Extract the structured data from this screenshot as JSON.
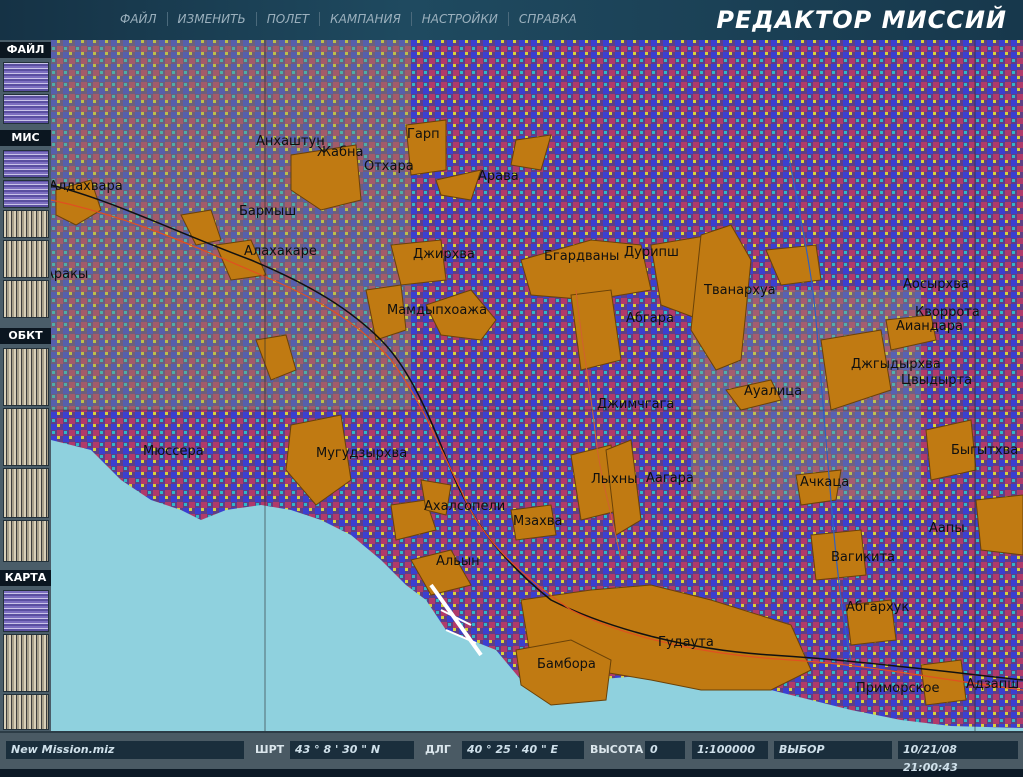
{
  "menu": [
    "ФАЙЛ",
    "ИЗМЕНИТЬ",
    "ПОЛЕТ",
    "КАМПАНИЯ",
    "НАСТРОЙКИ",
    "СПРАВКА"
  ],
  "app_title": "РЕДАКТОР МИССИЙ",
  "sections": {
    "file": "ФАЙЛ",
    "mission": "МИС",
    "object": "ОБКТ",
    "map": "КАРТА"
  },
  "cities": [
    "Анхаштун",
    "Жабна",
    "Отхара",
    "Гарп",
    "Арава",
    "Алдахвара",
    "Бармыш",
    "Алахакаре",
    "Джирхва",
    "Бгардваны",
    "Дурипш",
    "Тванархуа",
    "Аосырхва",
    "Кворрота",
    "Аиандара",
    "Цвыдырта",
    "Джгыдырхва",
    "Аракы",
    "Мамдыпхоажа",
    "Абгара",
    "Ауалица",
    "Джимчгага",
    "Мюссера",
    "Мугудзырхва",
    "Лыхны",
    "Аагара",
    "Ачкаца",
    "Быгытхва",
    "Ахалсопели",
    "Мзахва",
    "Аапы",
    "Вагикита",
    "Альын",
    "Абгархук",
    "Гудаута",
    "Бамбора",
    "Приморское",
    "Адзапш"
  ],
  "status": {
    "file_name": "New Mission.miz",
    "lat_label": "ШРТ",
    "lat_value": "43 ° 8 ' 30 \" N",
    "lon_label": "ДЛГ",
    "lon_value": "40 ° 25 ' 40 \" E",
    "alt_label": "ВЫСОТА",
    "alt_value": "0",
    "scale": "1:100000",
    "mode": "ВЫБОР",
    "datetime": "10/21/08 21:00:43"
  },
  "colors": {
    "terrain": "#5e3f86",
    "sea": "#8fd1de",
    "settlement": "#c07a12",
    "panel": "#4a5a64"
  }
}
